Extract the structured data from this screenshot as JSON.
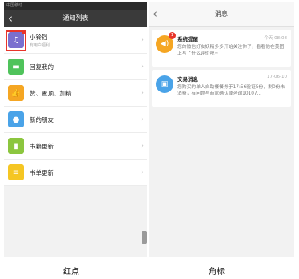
{
  "left": {
    "status_text": "中国移动",
    "title": "通知列表",
    "rows": [
      {
        "title": "小铃铛",
        "sub": "有用户福利",
        "color": "#7a6fcf",
        "icon": "bell-icon"
      },
      {
        "title": "回复我的",
        "sub": "",
        "color": "#4fc35b",
        "icon": "chat-icon"
      },
      {
        "title": "赞、置顶、加精",
        "sub": "",
        "color": "#f5a623",
        "icon": "thumb-icon"
      },
      {
        "title": "新的朋友",
        "sub": "",
        "color": "#4aa3e8",
        "icon": "person-icon"
      },
      {
        "title": "书籍更新",
        "sub": "",
        "color": "#8cc63f",
        "icon": "book-icon"
      },
      {
        "title": "书单更新",
        "sub": "",
        "color": "#f5c623",
        "icon": "booklist-icon"
      }
    ]
  },
  "right": {
    "title": "消息",
    "messages": [
      {
        "title": "系统提醒",
        "time": "今天 08:08",
        "body": "您的微信好友妖精多多开始关注你了，看看他在美团上写了什么评价吧~",
        "badge": "1",
        "color": "#f5a623",
        "icon": "speaker-icon"
      },
      {
        "title": "交易消息",
        "time": "17-06-10",
        "body": "您购买的单人自助餐餐券于17:56验证5份，剩0份未消费，有问题与商家确认或咨询10107...",
        "badge": "",
        "color": "#4aa3e8",
        "icon": "ticket-icon"
      }
    ]
  },
  "captions": {
    "left": "红点",
    "right": "角标"
  }
}
